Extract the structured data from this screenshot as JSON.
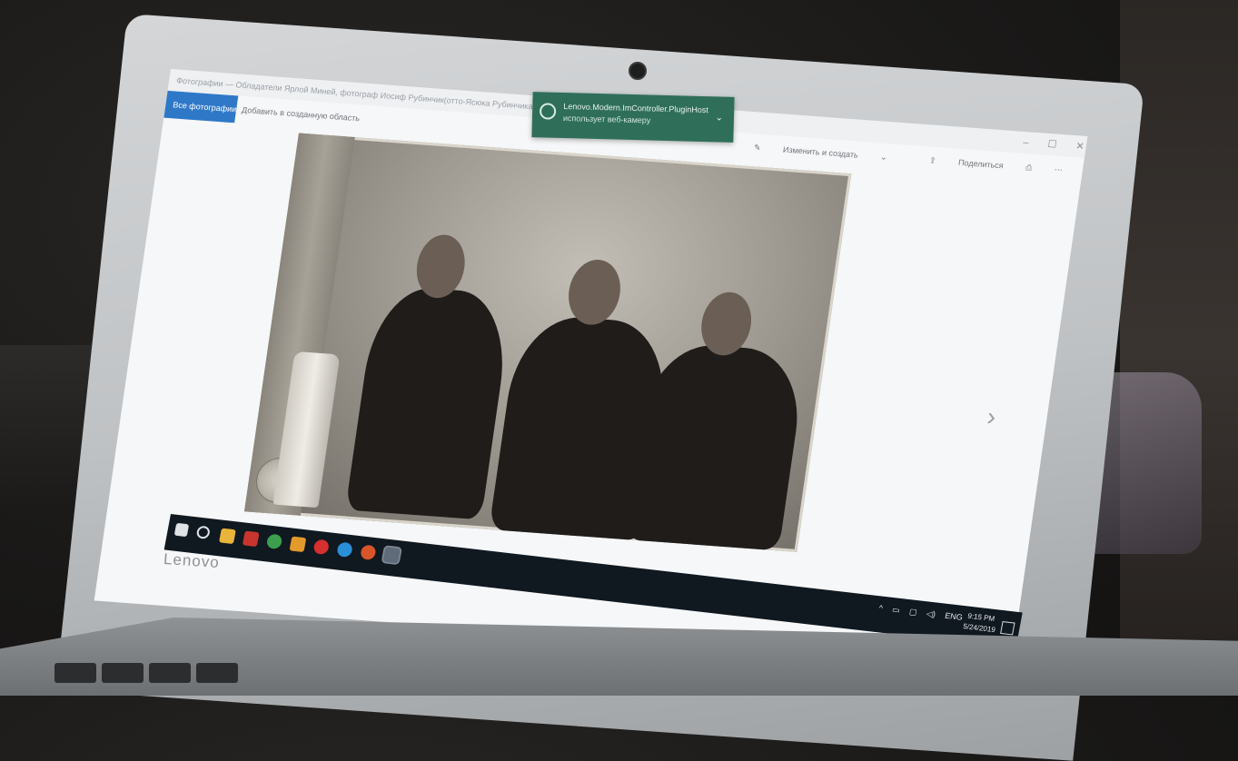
{
  "window": {
    "title": "Фотографии — Обладатели Ярлой Миней, фотограф Иосиф Рубинчик(отто-Ясюка Рубинчика), ар...",
    "controls": [
      "–",
      "☐",
      "✕"
    ]
  },
  "toolbar": {
    "all_photos_label": "Все фотографии",
    "add_creation_label": "Добавить в созданную область"
  },
  "right_tools": {
    "edit_create_label": "Изменить и создать",
    "share_label": "Поделиться",
    "print_icon": "printer-icon"
  },
  "toast": {
    "title": "Lenovo.Modern.ImController.PluginHost",
    "body": "использует веб-камеру"
  },
  "taskbar": {
    "lang": "ENG",
    "time": "9:15 PM",
    "date": "5/24/2019"
  },
  "laptop": {
    "brand": "Lenovo"
  },
  "colors": {
    "accent": "#2f78c8",
    "toast_bg": "#2f6f5a",
    "taskbar_bg": "#101820"
  }
}
